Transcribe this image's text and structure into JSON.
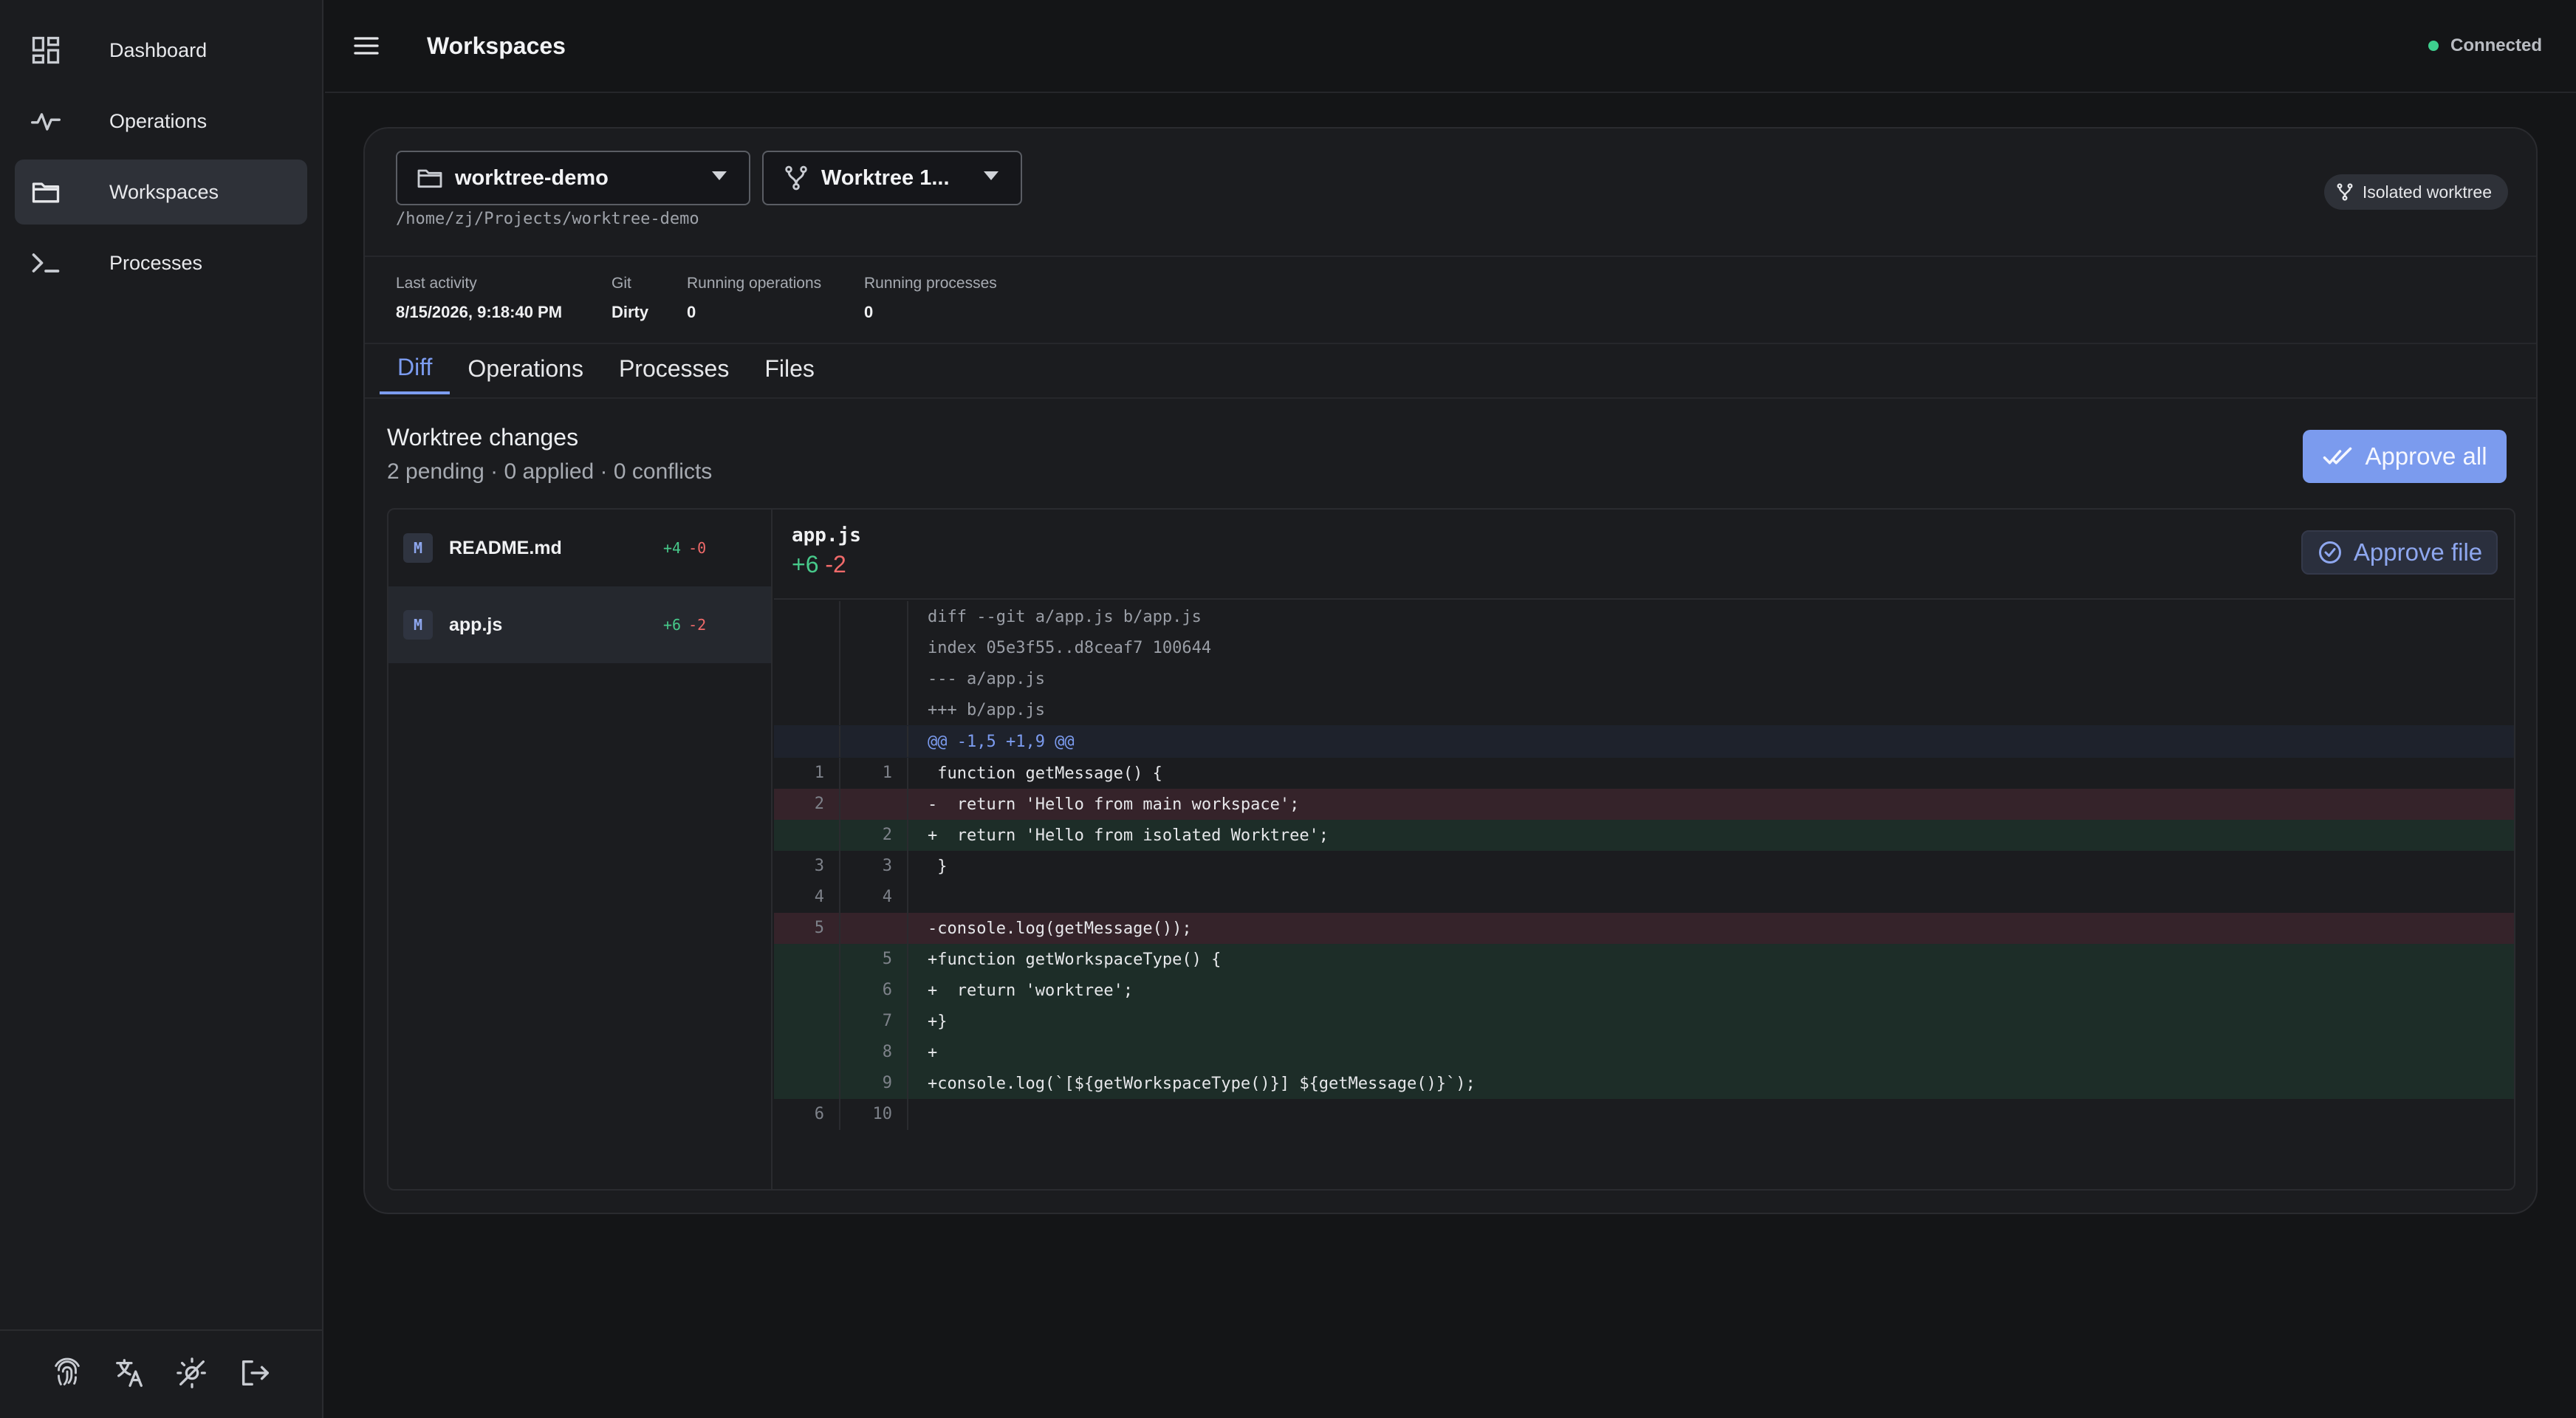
{
  "sidebar": {
    "items": [
      {
        "label": "Dashboard",
        "icon": "dashboard-icon"
      },
      {
        "label": "Operations",
        "icon": "activity-icon"
      },
      {
        "label": "Workspaces",
        "icon": "folder-icon"
      },
      {
        "label": "Processes",
        "icon": "terminal-icon"
      }
    ],
    "footer_icons": [
      "fingerprint-icon",
      "translate-icon",
      "theme-toggle-icon",
      "logout-icon"
    ]
  },
  "header": {
    "title": "Workspaces",
    "status": "Connected"
  },
  "workspace": {
    "repo": "worktree-demo",
    "worktree": "Worktree 1...",
    "path": "/home/zj/Projects/worktree-demo",
    "badge": "Isolated worktree"
  },
  "meta": {
    "last_activity_label": "Last activity",
    "last_activity": "8/15/2026, 9:18:40 PM",
    "git_label": "Git",
    "git": "Dirty",
    "running_ops_label": "Running operations",
    "running_ops": "0",
    "running_procs_label": "Running processes",
    "running_procs": "0"
  },
  "tabs": [
    "Diff",
    "Operations",
    "Processes",
    "Files"
  ],
  "changes": {
    "title": "Worktree changes",
    "summary": "2 pending · 0 applied · 0 conflicts",
    "approve_all": "Approve all"
  },
  "files": [
    {
      "status": "M",
      "name": "README.md",
      "added": "+4",
      "removed": "-0"
    },
    {
      "status": "M",
      "name": "app.js",
      "added": "+6",
      "removed": "-2"
    }
  ],
  "diff": {
    "file": "app.js",
    "added": "+6",
    "removed": "-2",
    "approve_file": "Approve file",
    "lines": [
      {
        "type": "meta",
        "old": "",
        "new": "",
        "text": "diff --git a/app.js b/app.js"
      },
      {
        "type": "meta",
        "old": "",
        "new": "",
        "text": "index 05e3f55..d8ceaf7 100644"
      },
      {
        "type": "meta",
        "old": "",
        "new": "",
        "text": "--- a/app.js"
      },
      {
        "type": "meta",
        "old": "",
        "new": "",
        "text": "+++ b/app.js"
      },
      {
        "type": "hunk",
        "old": "",
        "new": "",
        "text": "@@ -1,5 +1,9 @@"
      },
      {
        "type": "context",
        "old": "1",
        "new": "1",
        "text": " function getMessage() {"
      },
      {
        "type": "removed",
        "old": "2",
        "new": "",
        "text": "-  return 'Hello from main workspace';"
      },
      {
        "type": "added",
        "old": "",
        "new": "2",
        "text": "+  return 'Hello from isolated Worktree';"
      },
      {
        "type": "context",
        "old": "3",
        "new": "3",
        "text": " }"
      },
      {
        "type": "context",
        "old": "4",
        "new": "4",
        "text": ""
      },
      {
        "type": "removed",
        "old": "5",
        "new": "",
        "text": "-console.log(getMessage());"
      },
      {
        "type": "added",
        "old": "",
        "new": "5",
        "text": "+function getWorkspaceType() {"
      },
      {
        "type": "added",
        "old": "",
        "new": "6",
        "text": "+  return 'worktree';"
      },
      {
        "type": "added",
        "old": "",
        "new": "7",
        "text": "+}"
      },
      {
        "type": "added",
        "old": "",
        "new": "8",
        "text": "+"
      },
      {
        "type": "added",
        "old": "",
        "new": "9",
        "text": "+console.log(`[${getWorkspaceType()}] ${getMessage()}`);"
      },
      {
        "type": "context",
        "old": "6",
        "new": "10",
        "text": ""
      }
    ]
  },
  "colors": {
    "accent": "#7b9bee",
    "added": "#47c98a",
    "removed": "#f06a6a",
    "connected": "#3ecf8e"
  }
}
